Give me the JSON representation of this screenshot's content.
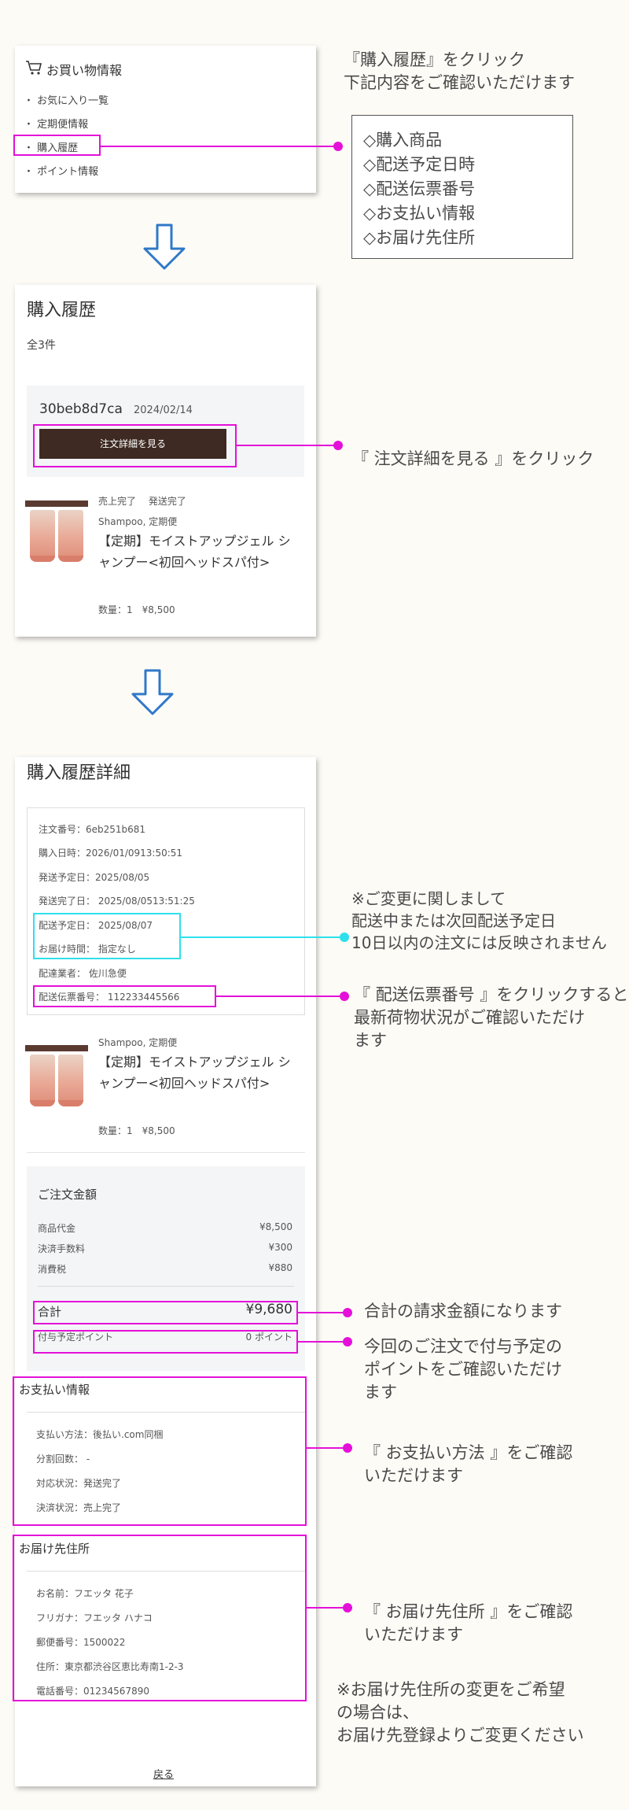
{
  "menu": {
    "title": "お買い物情報",
    "items": [
      "お気に入り一覧",
      "定期便情報",
      "購入履歴",
      "ポイント情報"
    ]
  },
  "note1": {
    "line1": "『購入履歴』をクリック",
    "line2": "下記内容をご確認いただけます",
    "box": [
      "◇購入商品",
      "◇配送予定日時",
      "◇配送伝票番号",
      "◇お支払い情報",
      "◇お届け先住所"
    ]
  },
  "history": {
    "title": "購入履歴",
    "count": "全3件",
    "order_id": "30beb8d7ca",
    "order_date": "2024/02/14",
    "detail_button": "注文詳細を見る",
    "status": "売上完了　 発送完了",
    "category": "Shampoo, 定期便",
    "product_name": "【定期】モイストアップジェル シャンプー<初回ヘッドスパ付>",
    "qty_price": "数量：1　¥8,500"
  },
  "note2": "『 注文詳細を見る 』をクリック",
  "detail": {
    "title": "購入履歴詳細",
    "info": [
      "注文番号：6eb251b681",
      "購入日時：2026/01/0913:50:51",
      "発送予定日：2025/08/05",
      "発送完了日： 2025/08/0513:51:25",
      "配送予定日： 2025/08/07",
      "お届け時間： 指定なし",
      "配達業者： 佐川急便",
      "配送伝票番号： 112233445566"
    ],
    "category": "Shampoo, 定期便",
    "product_name": "【定期】モイストアップジェル シャンプー<初回ヘッドスパ付>",
    "qty_price": "数量：1　¥8,500",
    "amount": {
      "title": "ご注文金額",
      "rows": [
        {
          "label": "商品代金",
          "value": "¥8,500"
        },
        {
          "label": "決済手数料",
          "value": "¥300"
        },
        {
          "label": "消費税",
          "value": "¥880"
        }
      ],
      "total_label": "合計",
      "total_value": "¥9,680",
      "points_label": "付与予定ポイント",
      "points_value": "0 ポイント"
    },
    "payment": {
      "title": "お支払い情報",
      "rows": [
        "支払い方法：後払い.com同梱",
        "分割回数： -",
        "対応状況：発送完了",
        "決済状況：売上完了"
      ]
    },
    "address": {
      "title": "お届け先住所",
      "rows": [
        "お名前：フエッタ 花子",
        "フリガナ：フエッタ ハナコ",
        "郵便番号：1500022",
        "住所：東京都渋谷区恵比寿南1-2-3",
        "電話番号：01234567890"
      ]
    },
    "back": "戻る"
  },
  "notes": {
    "change": [
      "※ご変更に関しまして",
      "配送中または次回配送予定日",
      "10日以内の注文には反映されません"
    ],
    "tracking": [
      "『 配送伝票番号 』をクリックすると",
      "最新荷物状況がご確認いただけ",
      "ます"
    ],
    "total": "合計の請求金額になります",
    "points": [
      "今回のご注文で付与予定の",
      "ポイントをご確認いただけ",
      "ます"
    ],
    "payment": [
      "『 お支払い方法 』をご確認",
      "いただけます"
    ],
    "address": [
      "『 お届け先住所 』をご確認",
      "いただけます"
    ],
    "address_change": [
      "※お届け先住所の変更をご希望",
      "の場合は、",
      "お届け先登録よりご変更ください"
    ]
  }
}
